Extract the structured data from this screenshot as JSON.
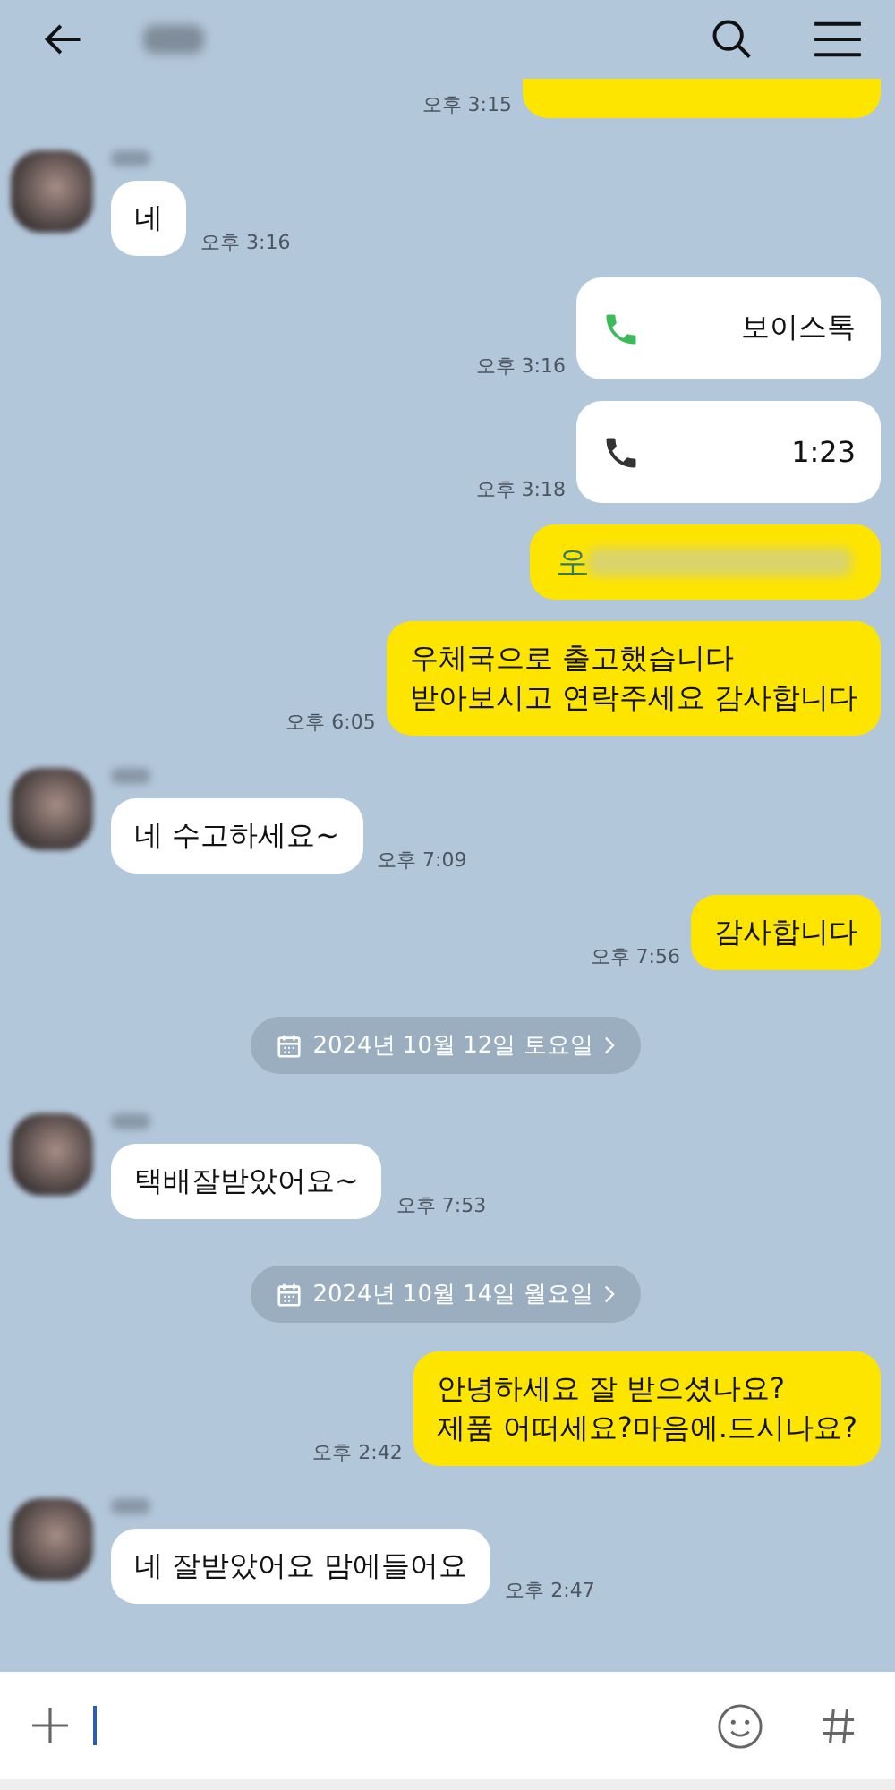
{
  "messages": [
    {
      "kind": "sent_cut",
      "time": "오후 3:15"
    },
    {
      "kind": "received",
      "text": "네",
      "time": "오후 3:16"
    },
    {
      "kind": "call",
      "label": "보이스톡",
      "color": "#3dba5b",
      "time": "오후 3:16"
    },
    {
      "kind": "call",
      "label": "1:23",
      "color": "#333333",
      "time": "오후 3:18"
    },
    {
      "kind": "sent_redacted",
      "text": "우"
    },
    {
      "kind": "sent",
      "lines": [
        "우체국으로 출고했습니다",
        "받아보시고 연락주세요 감사합니다"
      ],
      "time": "오후 6:05"
    },
    {
      "kind": "received",
      "text": "네 수고하세요~",
      "time": "오후 7:09"
    },
    {
      "kind": "sent",
      "lines": [
        "감사합니다"
      ],
      "time": "오후 7:56"
    },
    {
      "kind": "date",
      "text": "2024년 10월 12일 토요일"
    },
    {
      "kind": "received",
      "text": "택배잘받았어요~",
      "time": "오후 7:53"
    },
    {
      "kind": "date",
      "text": "2024년 10월 14일 월요일"
    },
    {
      "kind": "sent",
      "lines": [
        "안녕하세요 잘 받으셨나요?",
        "제품 어떠세요?마음에.드시나요?"
      ],
      "time": "오후 2:42"
    },
    {
      "kind": "received",
      "text": "네 잘받았어요 맘에들어요",
      "time": "오후 2:47"
    }
  ]
}
